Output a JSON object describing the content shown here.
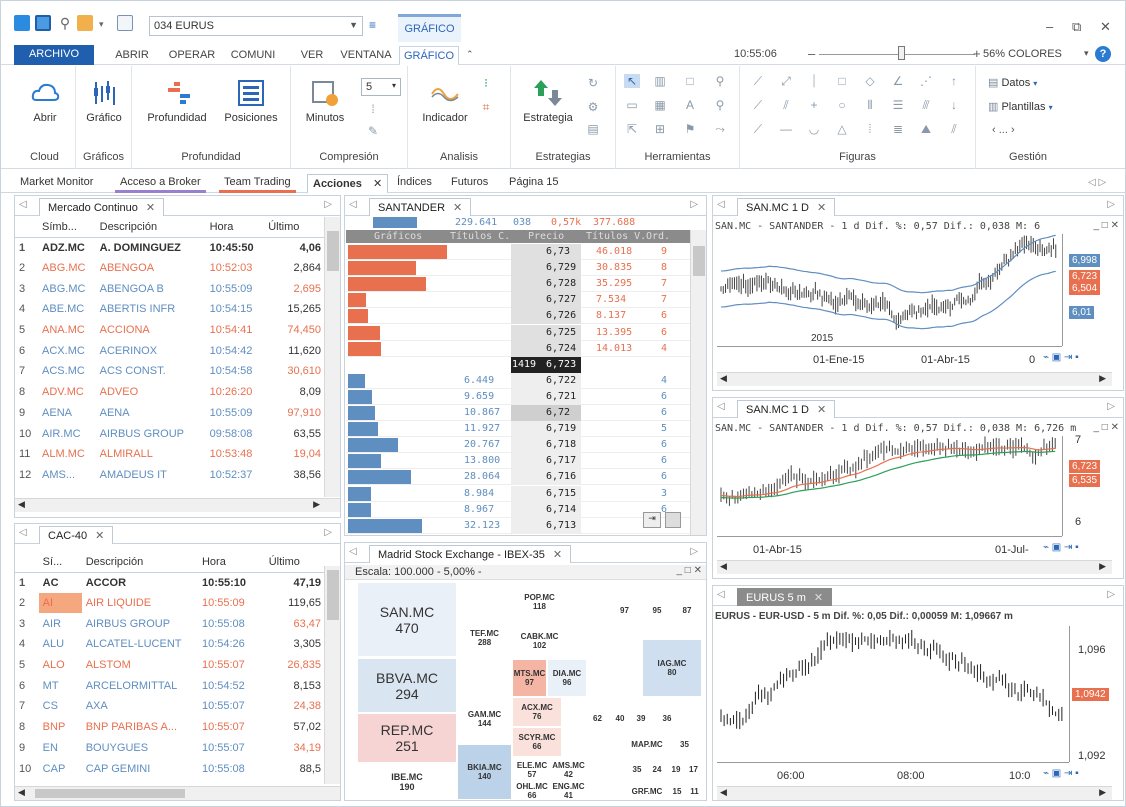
{
  "titlebar": {
    "symbol": "034 EURUS",
    "context_tab": "GRÁFICO"
  },
  "menu": {
    "tabs": [
      "ARCHIVO",
      "ABRIR",
      "OPERAR",
      "COMUNI",
      "VER",
      "VENTANA",
      "GRÁFICO"
    ],
    "clock": "10:55:06",
    "zoom": "56%",
    "colors": "COLORES",
    "help": "?"
  },
  "ribbon": {
    "groups": [
      {
        "label": "Cloud",
        "buttons": [
          "Abrir"
        ]
      },
      {
        "label": "Gráficos",
        "buttons": [
          "Gráfico"
        ]
      },
      {
        "label": "Profundidad",
        "buttons": [
          "Profundidad",
          "Posiciones"
        ]
      },
      {
        "label": "Compresión",
        "buttons": [
          "Minutos"
        ],
        "spinner": "5"
      },
      {
        "label": "Analisis",
        "buttons": [
          "Indicador"
        ]
      },
      {
        "label": "Estrategias",
        "buttons": [
          "Estrategia"
        ]
      },
      {
        "label": "Herramientas"
      },
      {
        "label": "Figuras"
      },
      {
        "label": "Gestión",
        "items": [
          "Datos",
          "Plantillas"
        ]
      }
    ]
  },
  "workspace_tabs": [
    "Market Monitor",
    "Acceso a Broker",
    "Team Trading",
    "Acciones",
    "Índices",
    "Futuros",
    "Página 15"
  ],
  "mercado": {
    "tab": "Mercado Continuo",
    "columns": [
      "Símb...",
      "Descripción",
      "Hora",
      "Último"
    ],
    "rows": [
      [
        "1",
        "ADZ.MC",
        "A. DOMINGUEZ",
        "10:45:50",
        "4,06"
      ],
      [
        "2",
        "ABG.MC",
        "ABENGOA",
        "10:52:03",
        "2,864"
      ],
      [
        "3",
        "ABG.MC",
        "ABENGOA B",
        "10:55:09",
        "2,695"
      ],
      [
        "4",
        "ABE.MC",
        "ABERTIS INFR",
        "10:54:15",
        "15,265"
      ],
      [
        "5",
        "ANA.MC",
        "ACCIONA",
        "10:54:41",
        "74,450"
      ],
      [
        "6",
        "ACX.MC",
        "ACERINOX",
        "10:54:42",
        "11,620"
      ],
      [
        "7",
        "ACS.MC",
        "ACS CONST.",
        "10:54:58",
        "30,610"
      ],
      [
        "8",
        "ADV.MC",
        "ADVEO",
        "10:26:20",
        "8,09"
      ],
      [
        "9",
        "AENA",
        "AENA",
        "10:55:09",
        "97,910"
      ],
      [
        "10",
        "AIR.MC",
        "AIRBUS GROUP",
        "09:58:08",
        "63,55"
      ],
      [
        "11",
        "ALM.MC",
        "ALMIRALL",
        "10:53:48",
        "19,04"
      ],
      [
        "12",
        "AMS...",
        "AMADEUS IT",
        "10:52:37",
        "38,56"
      ]
    ]
  },
  "cac": {
    "tab": "CAC-40",
    "columns": [
      "Sí...",
      "Descripción",
      "Hora",
      "Último"
    ],
    "rows": [
      [
        "1",
        "AC",
        "ACCOR",
        "10:55:10",
        "47,19"
      ],
      [
        "2",
        "AI",
        "AIR LIQUIDE",
        "10:55:09",
        "119,65"
      ],
      [
        "3",
        "AIR",
        "AIRBUS GROUP",
        "10:55:08",
        "63,47"
      ],
      [
        "4",
        "ALU",
        "ALCATEL-LUCENT",
        "10:54:26",
        "3,305"
      ],
      [
        "5",
        "ALO",
        "ALSTOM",
        "10:55:07",
        "26,835"
      ],
      [
        "6",
        "MT",
        "ARCELORMITTAL",
        "10:54:52",
        "8,153"
      ],
      [
        "7",
        "CS",
        "AXA",
        "10:55:07",
        "24,38"
      ],
      [
        "8",
        "BNP",
        "BNP PARIBAS A...",
        "10:55:07",
        "57,02"
      ],
      [
        "9",
        "EN",
        "BOUYGUES",
        "10:55:07",
        "34,19"
      ],
      [
        "10",
        "CAP",
        "CAP GEMINI",
        "10:55:08",
        "88,5"
      ]
    ]
  },
  "depth": {
    "tab": "SANTANDER",
    "summary": [
      "229.641",
      "038",
      "0,57k",
      "377.688"
    ],
    "columns": [
      "Gráficos",
      "Títulos C.",
      "Precio",
      "Títulos V.",
      "Ord."
    ],
    "asks": [
      {
        "price": "6,73",
        "qty": "46.018",
        "ord": "9",
        "bar": 0.66
      },
      {
        "price": "6,729",
        "qty": "30.835",
        "ord": "8",
        "bar": 0.45
      },
      {
        "price": "6,728",
        "qty": "35.295",
        "ord": "7",
        "bar": 0.52
      },
      {
        "price": "6,727",
        "qty": "7.534",
        "ord": "7",
        "bar": 0.12
      },
      {
        "price": "6,726",
        "qty": "8.137",
        "ord": "6",
        "bar": 0.13
      },
      {
        "price": "6,725",
        "qty": "13.395",
        "ord": "6",
        "bar": 0.21
      },
      {
        "price": "6,724",
        "qty": "14.013",
        "ord": "4",
        "bar": 0.22
      }
    ],
    "last": {
      "qty": "1419",
      "price": "6,723"
    },
    "bids": [
      {
        "price": "6,722",
        "qty": "6.449",
        "ord": "4",
        "bar": 0.11
      },
      {
        "price": "6,721",
        "qty": "9.659",
        "ord": "6",
        "bar": 0.16
      },
      {
        "price": "6,72",
        "qty": "10.867",
        "ord": "6",
        "bar": 0.18
      },
      {
        "price": "6,719",
        "qty": "11.927",
        "ord": "5",
        "bar": 0.2
      },
      {
        "price": "6,718",
        "qty": "20.767",
        "ord": "6",
        "bar": 0.33
      },
      {
        "price": "6,717",
        "qty": "13.800",
        "ord": "6",
        "bar": 0.22
      },
      {
        "price": "6,716",
        "qty": "28.064",
        "ord": "6",
        "bar": 0.42
      },
      {
        "price": "6,715",
        "qty": "8.984",
        "ord": "3",
        "bar": 0.15
      },
      {
        "price": "6,714",
        "qty": "8.967",
        "ord": "6",
        "bar": 0.15
      },
      {
        "price": "6,713",
        "qty": "32.123",
        "ord": "",
        "bar": 0.49
      }
    ]
  },
  "heatmap": {
    "tab": "Madrid Stock Exchange - IBEX-35",
    "scale": "Escala: 100.000 - 5,00% -",
    "cells": [
      {
        "name": "SAN.MC",
        "val": "470"
      },
      {
        "name": "BBVA.MC",
        "val": "294"
      },
      {
        "name": "REP.MC",
        "val": "251"
      },
      {
        "name": "IBE.MC",
        "val": "190"
      },
      {
        "name": "TEF.MC",
        "val": "288"
      },
      {
        "name": "GAM.MC",
        "val": "144"
      },
      {
        "name": "BKIA.MC",
        "val": "140"
      },
      {
        "name": "POP.MC",
        "val": "118"
      },
      {
        "name": "CABK.MC",
        "val": "102"
      },
      {
        "name": "MTS.MC",
        "val": "97"
      },
      {
        "name": "DIA.MC",
        "val": "96"
      },
      {
        "name": "IAG.MC",
        "val": "80"
      },
      {
        "name": "ACX.MC",
        "val": "76"
      },
      {
        "name": "SCYR.MC",
        "val": "66"
      },
      {
        "name": "ELE.MC",
        "val": "57"
      },
      {
        "name": "AMS.MC",
        "val": "42"
      },
      {
        "name": "OHL.MC",
        "val": "66"
      },
      {
        "name": "ENG.MC",
        "val": "41"
      },
      {
        "name": "MAP.MC",
        "val": ""
      },
      {
        "name": "GRF.MC",
        "val": ""
      },
      {
        "name": "",
        "val": "97"
      },
      {
        "name": "",
        "val": "95"
      },
      {
        "name": "",
        "val": "87"
      },
      {
        "name": "",
        "val": "62"
      },
      {
        "name": "",
        "val": "40"
      },
      {
        "name": "",
        "val": "39"
      },
      {
        "name": "",
        "val": "36"
      },
      {
        "name": "",
        "val": "35"
      },
      {
        "name": "",
        "val": "35"
      },
      {
        "name": "",
        "val": "24"
      },
      {
        "name": "",
        "val": "19"
      },
      {
        "name": "",
        "val": "17"
      },
      {
        "name": "",
        "val": "15"
      },
      {
        "name": "",
        "val": "11"
      }
    ]
  },
  "chart1": {
    "tab": "SAN.MC 1 D",
    "title": "SAN.MC - SANTANDER - 1 d Dif. %: 0,57 Dif.: 0,038 M: 6",
    "prices": [
      "6,998",
      "6,723",
      "6,504",
      "6,01"
    ],
    "year": "2015",
    "xlabels": [
      "01-Ene-15",
      "01-Abr-15",
      "0"
    ]
  },
  "chart2": {
    "tab": "SAN.MC 1 D",
    "title": "SAN.MC - SANTANDER - 1 d Dif. %: 0,57 Dif.: 0,038 M: 6,726 m",
    "yticks": [
      "7",
      "6"
    ],
    "prices": [
      "6,723",
      "6,535"
    ],
    "xlabels": [
      "01-Abr-15",
      "01-Jul-"
    ]
  },
  "chart3": {
    "tab": "EURUS 5 m",
    "title": "EURUS - EUR-USD - 5 m Dif. %: 0,05 Dif.: 0,00059 M: 1,09667 m",
    "yticks": [
      "1,096",
      "1,092"
    ],
    "price": "1,0942",
    "xlabels": [
      "06:00",
      "08:00",
      "10:0"
    ]
  },
  "colors": {
    "archivo": "#1f5fae",
    "red": "#e8704f",
    "blue": "#5f8ec0",
    "accent": "#2b66b8"
  }
}
